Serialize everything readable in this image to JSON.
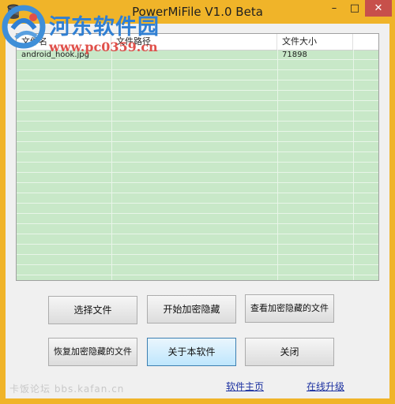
{
  "window": {
    "title": "PowerMiFile V1.0 Beta",
    "minimize_glyph": "–",
    "maximize_glyph": "□",
    "close_glyph": "✕",
    "accent": "#f0b429"
  },
  "watermark": {
    "site_name": "河东软件园",
    "site_url": "www.pc0359.cn",
    "forum_text": "卡饭论坛 bbs.kafan.cn"
  },
  "file_list": {
    "columns": [
      "文件名",
      "文件路径",
      "文件大小"
    ],
    "rows": [
      {
        "name": "android_hook.jpg",
        "path": "",
        "size": "71898"
      }
    ]
  },
  "buttons": {
    "select_file": "选择文件",
    "start_encrypt_hide": "开始加密隐藏",
    "view_encrypted_files": "查看加密隐藏的文件",
    "restore_encrypted_files": "恢复加密隐藏的文件",
    "about": "关于本软件",
    "close": "关闭"
  },
  "links": {
    "homepage": "软件主页",
    "online_upgrade": "在线升级"
  }
}
